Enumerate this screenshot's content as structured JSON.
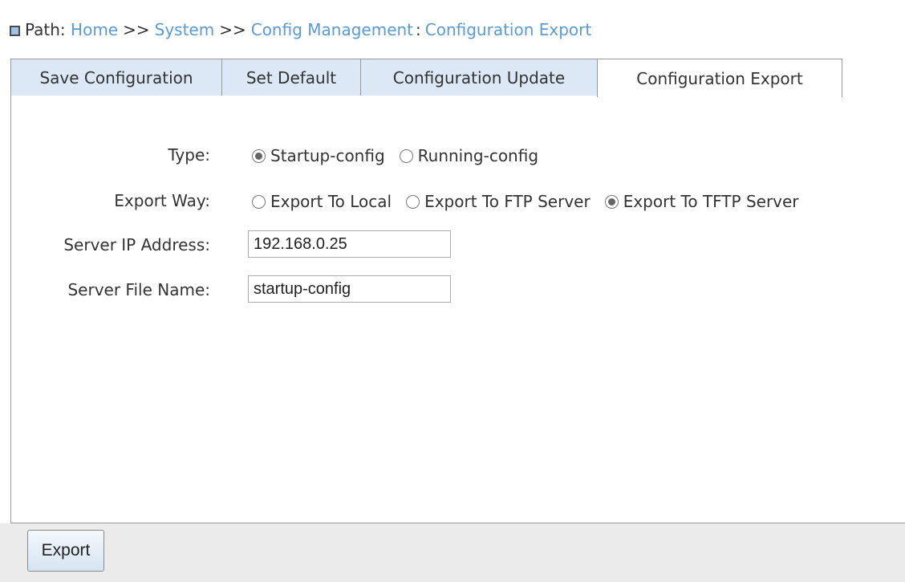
{
  "breadcrumb": {
    "label": "Path:",
    "items": [
      "Home",
      "System",
      "Config Management",
      "Configuration Export"
    ],
    "separator": ">>",
    "last_separator": ":"
  },
  "tabs": [
    {
      "label": "Save Configuration",
      "active": false
    },
    {
      "label": "Set Default",
      "active": false
    },
    {
      "label": "Configuration Update",
      "active": false
    },
    {
      "label": "Configuration Export",
      "active": true
    }
  ],
  "form": {
    "type": {
      "label": "Type:",
      "options": [
        {
          "label": "Startup-config",
          "checked": true
        },
        {
          "label": "Running-config",
          "checked": false
        }
      ]
    },
    "export_way": {
      "label": "Export Way:",
      "options": [
        {
          "label": "Export To Local",
          "checked": false
        },
        {
          "label": "Export To FTP Server",
          "checked": false
        },
        {
          "label": "Export To TFTP Server",
          "checked": true
        }
      ]
    },
    "server_ip": {
      "label": "Server IP Address:",
      "value": "192.168.0.25"
    },
    "server_file": {
      "label": "Server File Name:",
      "value": "startup-config"
    }
  },
  "actions": {
    "export_label": "Export"
  },
  "colors": {
    "link": "#5b9bd5",
    "tab_inactive": "#dce8f5",
    "footer": "#ebebeb"
  }
}
